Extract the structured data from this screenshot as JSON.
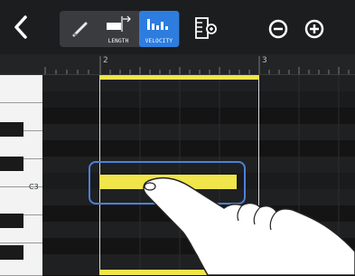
{
  "toolbar": {
    "back_icon": "chevron-left-icon",
    "tools": [
      {
        "name": "pencil",
        "icon": "pencil-icon",
        "label": ""
      },
      {
        "name": "length",
        "icon": "length-icon",
        "label": "LENGTH"
      },
      {
        "name": "velocity",
        "icon": "velocity-icon",
        "label": "VELOCITY",
        "active": true
      }
    ],
    "zoom_keyboard_icon": "keyboard-zoom-icon",
    "zoom_out_icon": "zoom-out-icon",
    "zoom_in_icon": "zoom-in-icon"
  },
  "ruler": {
    "measures": [
      "2",
      "3"
    ]
  },
  "keyboard": {
    "c3_label": "C3"
  },
  "colors": {
    "accent": "#2d7de0",
    "note": "#f0e54a",
    "selection_frame": "#4d7fd8"
  }
}
